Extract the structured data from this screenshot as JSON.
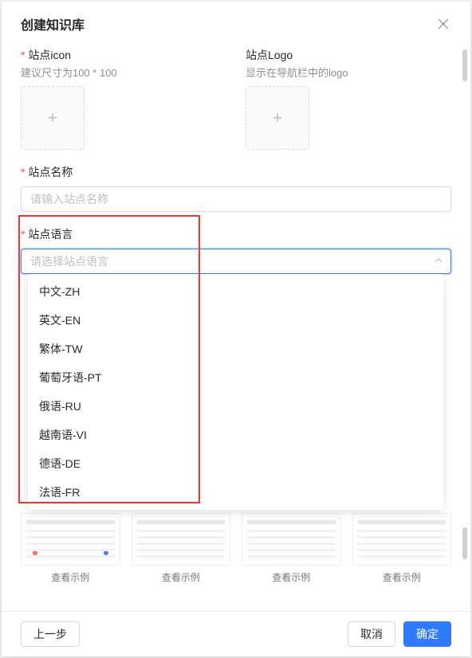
{
  "modal": {
    "title": "创建知识库"
  },
  "fields": {
    "icon": {
      "label": "站点icon",
      "hint": "建议尺寸为100 * 100"
    },
    "logo": {
      "label": "站点Logo",
      "hint": "显示在导航栏中的logo"
    },
    "siteName": {
      "label": "站点名称",
      "placeholder": "请输入站点名称"
    },
    "siteLang": {
      "label": "站点语言",
      "placeholder": "请选择站点语言",
      "options": [
        "中文-ZH",
        "英文-EN",
        "繁体-TW",
        "葡萄牙语-PT",
        "俄语-RU",
        "越南语-VI",
        "德语-DE",
        "法语-FR"
      ]
    }
  },
  "thumbs": {
    "viewExample": "查看示例"
  },
  "footer": {
    "prev": "上一步",
    "cancel": "取消",
    "ok": "确定"
  }
}
